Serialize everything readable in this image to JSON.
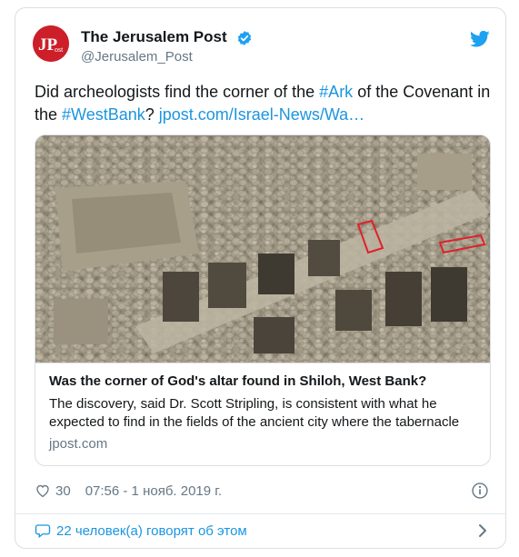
{
  "tweet": {
    "author_name": "The Jerusalem Post",
    "handle": "@Jerusalem_Post",
    "avatar_text": "JPost",
    "text_parts": {
      "t1": "Did archeologists find the corner of the ",
      "h1": "#Ark",
      "t2": " of the Covenant in the ",
      "h2": "#WestBank",
      "t3": "? ",
      "url": "jpost.com/Israel-News/Wa…"
    },
    "link_card": {
      "title": "Was the corner of God's altar found in Shiloh, West Bank?",
      "description": "The discovery, said Dr. Scott Stripling, is consistent with what he expected to find in the fields of the ancient city where the tabernacle",
      "domain": "jpost.com"
    },
    "likes": "30",
    "timestamp": "07:56 - 1 нояб. 2019 г.",
    "footer_text": "22 человек(а) говорят об этом"
  },
  "icons": {
    "verified": "verified-badge-icon",
    "bird": "twitter-bird-icon",
    "heart": "heart-icon",
    "info": "info-icon",
    "bubble": "comment-bubble-icon",
    "chevron": "chevron-right-icon"
  },
  "colors": {
    "link": "#1b95e0",
    "secondary": "#657786",
    "avatar_bg": "#cc1f2a",
    "highlight_box": "#e0202a"
  }
}
